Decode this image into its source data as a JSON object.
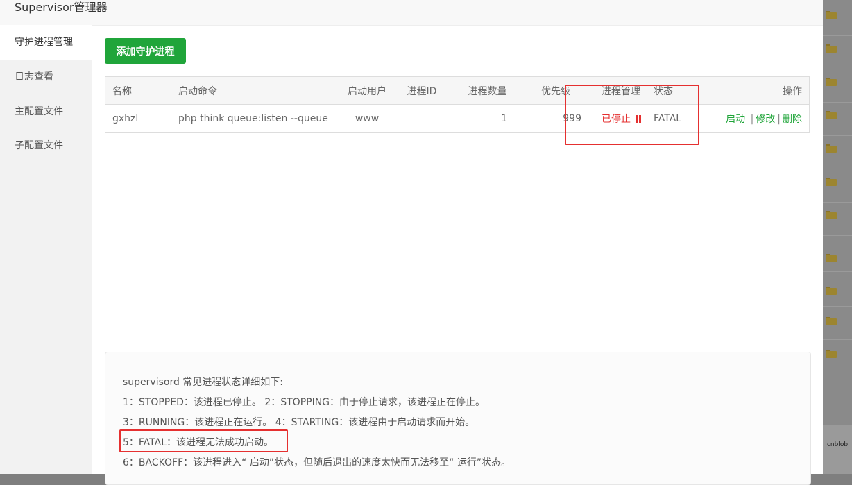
{
  "window": {
    "title": "Supervisor管理器"
  },
  "sidebar": {
    "items": [
      {
        "label": "守护进程管理",
        "active": true
      },
      {
        "label": "日志查看",
        "active": false
      },
      {
        "label": "主配置文件",
        "active": false
      },
      {
        "label": "子配置文件",
        "active": false
      }
    ]
  },
  "toolbar": {
    "add_label": "添加守护进程"
  },
  "table": {
    "headers": {
      "name": "名称",
      "command": "启动命令",
      "user": "启动用户",
      "pid": "进程ID",
      "count": "进程数量",
      "priority": "优先级",
      "manage": "进程管理",
      "status": "状态",
      "ops": "操作"
    },
    "rows": [
      {
        "name": "gxhzl",
        "command": "php think queue:listen --queue",
        "user": "www",
        "pid": "",
        "count": "1",
        "priority": "999",
        "manage": "已停止",
        "status": "FATAL",
        "op_start": "启动",
        "op_edit": "修改",
        "op_delete": "删除",
        "separator": "|"
      }
    ]
  },
  "info": {
    "heading": "supervisord 常见进程状态详细如下:",
    "line1": "1：STOPPED：该进程已停止。     2：STOPPING：由于停止请求，该进程正在停止。",
    "line2": "3：RUNNING：该进程正在运行。 4：STARTING：该进程由于启动请求而开始。",
    "line3": "5：FATAL：该进程无法成功启动。",
    "line4": "6：BACKOFF：该进程进入“ 启动”状态，但随后退出的速度太快而无法移至“ 运行”状态。"
  },
  "watermark": "cnblob",
  "colors": {
    "accent": "#20a53a",
    "stopped": "#e53030",
    "highlight_box": "#e53030"
  },
  "icons": {
    "stopped_state": "pause-icon",
    "background_rows": "folder-icon"
  }
}
